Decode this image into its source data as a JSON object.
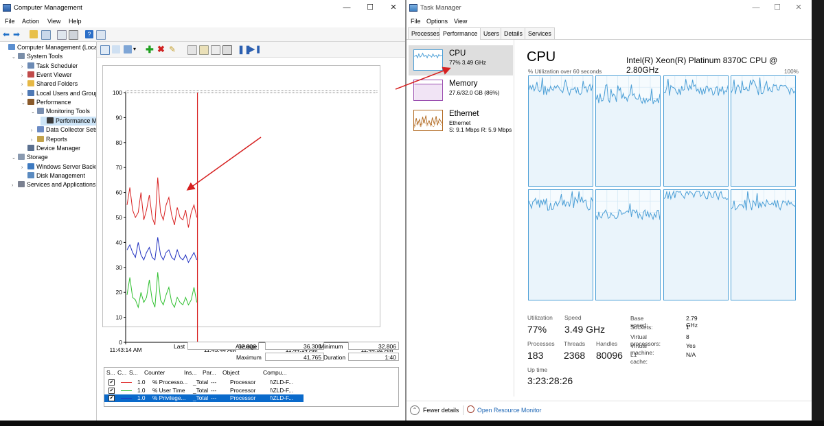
{
  "cm": {
    "title": "Computer Management",
    "menu": [
      "File",
      "Action",
      "View",
      "Help"
    ],
    "tree": [
      {
        "label": "Computer Management (Local",
        "level": 0,
        "arrow": ""
      },
      {
        "label": "System Tools",
        "level": 1,
        "arrow": "⌄"
      },
      {
        "label": "Task Scheduler",
        "level": 2,
        "arrow": "›"
      },
      {
        "label": "Event Viewer",
        "level": 2,
        "arrow": "›"
      },
      {
        "label": "Shared Folders",
        "level": 2,
        "arrow": "›"
      },
      {
        "label": "Local Users and Groups",
        "level": 2,
        "arrow": "›"
      },
      {
        "label": "Performance",
        "level": 2,
        "arrow": "⌄"
      },
      {
        "label": "Monitoring Tools",
        "level": 3,
        "arrow": "⌄"
      },
      {
        "label": "Performance Mo",
        "level": 4,
        "arrow": ""
      },
      {
        "label": "Data Collector Sets",
        "level": 3,
        "arrow": "›"
      },
      {
        "label": "Reports",
        "level": 3,
        "arrow": "›"
      },
      {
        "label": "Device Manager",
        "level": 2,
        "arrow": ""
      },
      {
        "label": "Storage",
        "level": 1,
        "arrow": "⌄"
      },
      {
        "label": "Windows Server Backup",
        "level": 2,
        "arrow": "›"
      },
      {
        "label": "Disk Management",
        "level": 2,
        "arrow": ""
      },
      {
        "label": "Services and Applications",
        "level": 1,
        "arrow": "›"
      }
    ]
  },
  "perfmon": {
    "y_ticks": [
      "100",
      "90",
      "80",
      "70",
      "60",
      "50",
      "40",
      "30",
      "20",
      "10",
      "0"
    ],
    "x_ticks": [
      "11:43:14 AM",
      "11:43:44 AM",
      "11:44:14 AM",
      "11:44:52 AM"
    ],
    "stats": {
      "last_label": "Last",
      "last": "32.806",
      "average_label": "Average",
      "average": "36.300",
      "minimum_label": "Minimum",
      "minimum": "32.806",
      "maximum_label": "Maximum",
      "maximum": "41.765",
      "duration_label": "Duration",
      "duration": "1:40"
    },
    "table_headers": [
      "S...",
      "C...",
      "S...",
      "Counter",
      "Ins...",
      "Par...",
      "Object",
      "Compu..."
    ],
    "rows": [
      {
        "color": "#e03030",
        "scale": "1.0",
        "counter": "% Processo...",
        "instance": "_Total",
        "parent": "---",
        "object": "Processor",
        "computer": "\\\\ZLD-F..."
      },
      {
        "color": "#40c040",
        "scale": "1.0",
        "counter": "% User Time",
        "instance": "_Total",
        "parent": "---",
        "object": "Processor",
        "computer": "\\\\ZLD-F..."
      },
      {
        "color": "#2030c0",
        "scale": "1.0",
        "counter": "% Privilege...",
        "instance": "_Total",
        "parent": "---",
        "object": "Processor",
        "computer": "\\\\ZLD-F..."
      }
    ]
  },
  "chart_data": {
    "type": "line",
    "ylim": [
      0,
      100
    ],
    "x_labels": [
      "11:43:14 AM",
      "11:43:44 AM",
      "11:44:14 AM",
      "11:44:52 AM"
    ],
    "series": [
      {
        "name": "% Processo...",
        "color": "#d82020",
        "values": [
          55,
          62,
          53,
          50,
          52,
          60,
          49,
          53,
          59,
          50,
          47,
          66,
          52,
          49,
          55,
          58,
          51,
          47,
          54,
          50,
          49,
          53,
          46,
          52,
          55,
          50
        ]
      },
      {
        "name": "% Privilege...",
        "color": "#2030c0",
        "values": [
          37,
          39,
          36,
          34,
          40,
          35,
          33,
          36,
          38,
          34,
          33,
          42,
          35,
          33,
          36,
          37,
          34,
          33,
          37,
          34,
          33,
          35,
          32,
          34,
          36,
          33
        ]
      },
      {
        "name": "% User Time",
        "color": "#30c030",
        "values": [
          19,
          26,
          18,
          17,
          14,
          20,
          16,
          18,
          25,
          17,
          14,
          28,
          17,
          15,
          19,
          22,
          16,
          14,
          18,
          16,
          15,
          18,
          15,
          17,
          22,
          16
        ]
      }
    ]
  },
  "tm": {
    "title": "Task Manager",
    "menu": [
      "File",
      "Options",
      "View"
    ],
    "tabs": [
      "Processes",
      "Performance",
      "Users",
      "Details",
      "Services"
    ],
    "side": [
      {
        "name": "CPU",
        "sub1": "77%  3.49 GHz",
        "sub2": ""
      },
      {
        "name": "Memory",
        "sub1": "27.6/32.0 GB (86%)",
        "sub2": ""
      },
      {
        "name": "Ethernet",
        "sub1": "Ethernet",
        "sub2": "S: 9.1 Mbps  R: 5.9 Mbps"
      }
    ],
    "cpu_title": "CPU",
    "cpu_model": "Intel(R) Xeon(R) Platinum 8370C CPU @ 2.80GHz",
    "util_label": "% Utilization over 60 seconds",
    "util_max": "100%",
    "metrics": {
      "utilization_label": "Utilization",
      "utilization": "77%",
      "speed_label": "Speed",
      "speed": "3.49 GHz",
      "processes_label": "Processes",
      "processes": "183",
      "threads_label": "Threads",
      "threads": "2368",
      "handles_label": "Handles",
      "handles": "80096",
      "uptime_label": "Up time",
      "uptime": "3:23:28:26"
    },
    "specs": [
      {
        "k": "Base speed:",
        "v": "2.79 GHz"
      },
      {
        "k": "Sockets:",
        "v": "1"
      },
      {
        "k": "Virtual processors:",
        "v": "8"
      },
      {
        "k": "Virtual machine:",
        "v": "Yes"
      },
      {
        "k": "L1 cache:",
        "v": "N/A"
      }
    ],
    "fewer_details": "Fewer details",
    "open_resmon": "Open Resource Monitor"
  },
  "colors": {
    "cpu_line": "#4a9ed6",
    "memory": "#9b4fb0",
    "ethernet": "#b26a22",
    "annotation": "#d62020"
  }
}
